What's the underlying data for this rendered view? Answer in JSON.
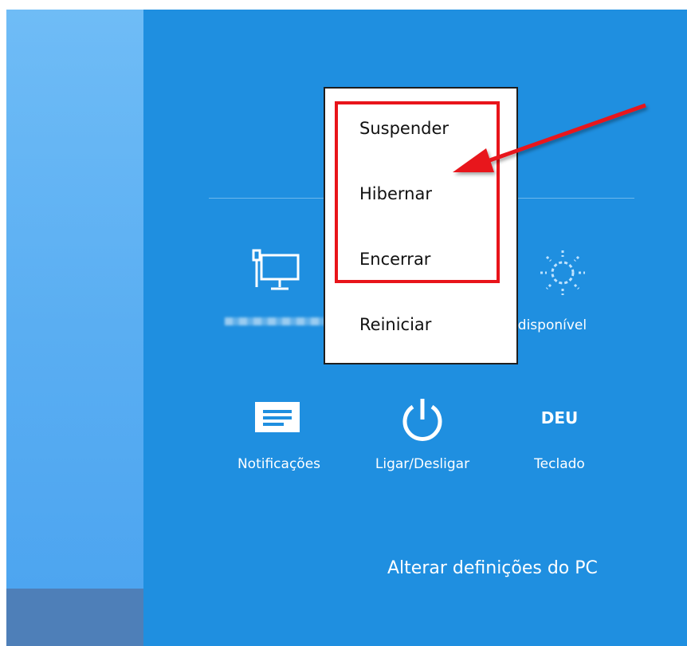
{
  "charms": {
    "tiles_row1": [
      {
        "id": "network",
        "label": "",
        "icon": "network-icon"
      },
      {
        "id": "brightness",
        "label": "Indisponível",
        "icon": "brightness-icon"
      }
    ],
    "tiles_row2": [
      {
        "id": "notifications",
        "label": "Notificações",
        "icon": "notifications-icon"
      },
      {
        "id": "power",
        "label": "Ligar/Desligar",
        "icon": "power-icon"
      },
      {
        "id": "keyboard",
        "label": "Teclado",
        "icon_text": "DEU"
      }
    ],
    "pc_settings_link": "Alterar definições do PC"
  },
  "power_menu": {
    "items": [
      "Suspender",
      "Hibernar",
      "Encerrar",
      "Reiniciar"
    ]
  },
  "annotation": {
    "highlight_color": "#e8141a",
    "arrow_color": "#e8141a"
  },
  "colors": {
    "panel_bg": "#1f8fe0",
    "left_bg": "#5aaef2",
    "taskbar": "#4e7fb8"
  }
}
